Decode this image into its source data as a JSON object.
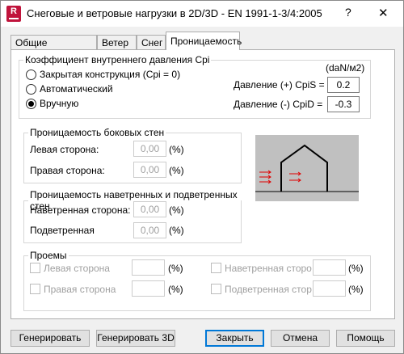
{
  "window": {
    "title": "Снеговые и ветровые нагрузки в 2D/3D - EN 1991-1-3/4:2005",
    "help": "?",
    "close": "✕",
    "app_icon_letter": "R"
  },
  "tabs": [
    {
      "label": "Общие параметры"
    },
    {
      "label": "Ветер"
    },
    {
      "label": "Снег"
    },
    {
      "label": "Проницаемость"
    }
  ],
  "cpi": {
    "legend": "Коэффициент внутреннего давления Cpi",
    "units": "(daN/м2)",
    "options": [
      "Закрытая конструкция (Cpi = 0)",
      "Автоматический",
      "Вручную"
    ],
    "selected": "Вручную",
    "pressure_pos_label": "Давление (+) CpiS =",
    "pressure_pos_value": "0.2",
    "pressure_neg_label": "Давление (-) CpiD =",
    "pressure_neg_value": "-0.3"
  },
  "side_walls": {
    "legend": "Проницаемость боковых стен",
    "left_label": "Левая сторона:",
    "left_value": "0,00",
    "right_label": "Правая сторона:",
    "right_value": "0,00",
    "unit": "(%)"
  },
  "windward": {
    "legend": "Проницаемость наветренных и подветренных стен",
    "windward_label": "Наветренная сторона:",
    "windward_value": "0,00",
    "leeward_label": "Подветренная",
    "leeward_value": "0,00",
    "unit": "(%)"
  },
  "openings": {
    "legend": "Проемы",
    "left_label": "Левая сторона",
    "right_label": "Правая сторона",
    "windward_label": "Наветренная сторона",
    "leeward_label": "Подветренная сторона",
    "unit": "(%)"
  },
  "buttons": {
    "generate": "Генерировать",
    "generate3d": "Генерировать 3D",
    "close": "Закрыть",
    "cancel": "Отмена",
    "help": "Помощь"
  },
  "colors": {
    "accent": "#0078d7",
    "arrow": "#e00000",
    "diagram_bg": "#c0c0c0",
    "app_icon": "#c0143c"
  }
}
